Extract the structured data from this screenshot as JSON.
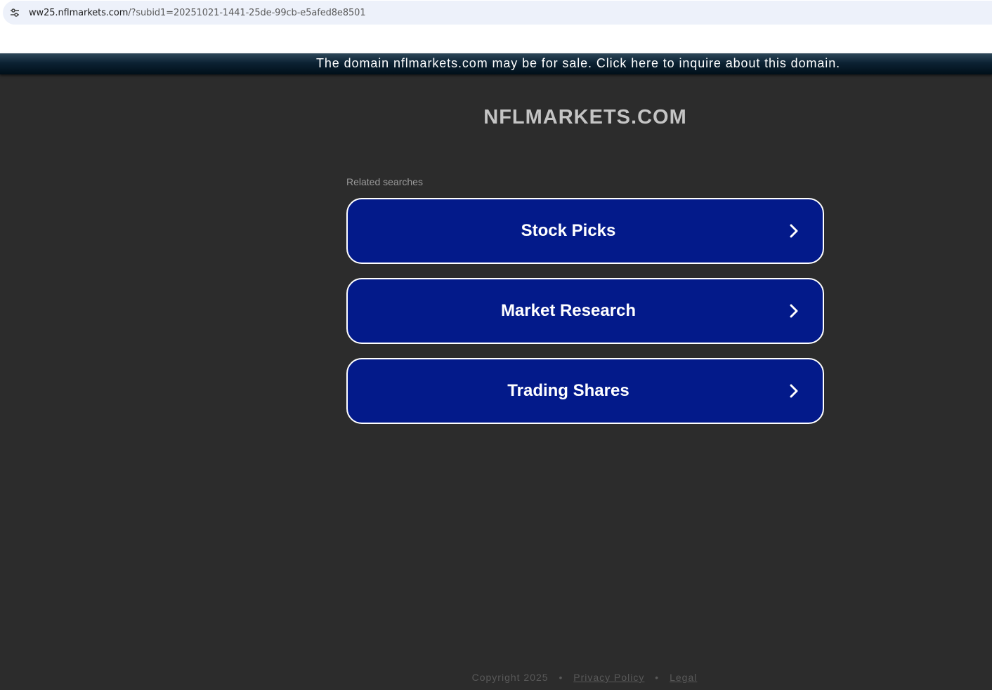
{
  "browser": {
    "url_host": "ww25.nflmarkets.com",
    "url_path": "/?subid1=20251021-1441-25de-99cb-e5afed8e8501",
    "site_info_icon": "tune-icon"
  },
  "banner": {
    "text": "The domain nflmarkets.com may be for sale. Click here to inquire about this domain."
  },
  "main": {
    "domain_title": "NFLMARKETS.COM",
    "related_label": "Related searches",
    "searches": [
      {
        "label": "Stock Picks",
        "icon": "chevron-right-icon"
      },
      {
        "label": "Market Research",
        "icon": "chevron-right-icon"
      },
      {
        "label": "Trading Shares",
        "icon": "chevron-right-icon"
      }
    ]
  },
  "footer": {
    "copyright": "Copyright 2025",
    "separator": "•",
    "privacy_label": "Privacy Policy",
    "legal_label": "Legal"
  },
  "colors": {
    "page_background": "#2c2c2c",
    "button_background": "#031a8a",
    "button_border": "#ffffff",
    "banner_dark": "#000f19",
    "title_text": "#c4c4c4",
    "address_bar": "#edf1fa"
  }
}
